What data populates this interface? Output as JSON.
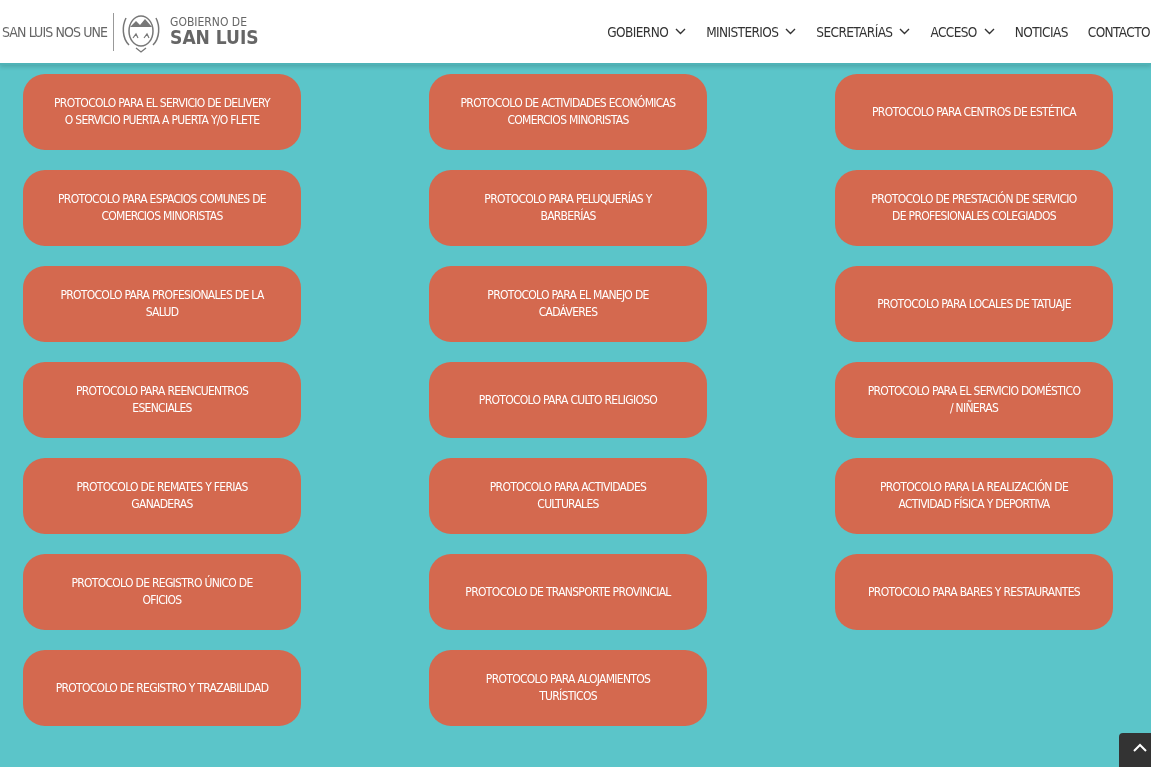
{
  "header": {
    "slogan": "SAN LUIS NOS UNE",
    "logo_line_1": "GOBIERNO DE",
    "logo_line_2": "SAN LUIS"
  },
  "nav": [
    {
      "label": "GOBIERNO",
      "dropdown": true
    },
    {
      "label": "MINISTERIOS",
      "dropdown": true
    },
    {
      "label": "SECRETARÍAS",
      "dropdown": true
    },
    {
      "label": "ACCESO",
      "dropdown": true
    },
    {
      "label": "NOTICIAS",
      "dropdown": false
    },
    {
      "label": "CONTACTO",
      "dropdown": false
    }
  ],
  "protocols": [
    {
      "label": "PROTOCOLO PARA EL SERVICIO DE DELIVERY O SERVICIO PUERTA A PUERTA Y/O FLETE"
    },
    {
      "label": "PROTOCOLO DE ACTIVIDADES ECONÓMICAS COMERCIOS MINORISTAS"
    },
    {
      "label": "PROTOCOLO PARA CENTROS DE ESTÉTICA"
    },
    {
      "label": "PROTOCOLO PARA ESPACIOS COMUNES DE COMERCIOS MINORISTAS"
    },
    {
      "label": "PROTOCOLO PARA PELUQUERÍAS Y BARBERÍAS"
    },
    {
      "label": "PROTOCOLO DE PRESTACIÓN DE SERVICIO DE PROFESIONALES COLEGIADOS"
    },
    {
      "label": "PROTOCOLO PARA PROFESIONALES DE LA SALUD"
    },
    {
      "label": "PROTOCOLO PARA EL MANEJO DE CADÁVERES"
    },
    {
      "label": "PROTOCOLO PARA LOCALES DE TATUAJE"
    },
    {
      "label": "PROTOCOLO PARA REENCUENTROS ESENCIALES"
    },
    {
      "label": "PROTOCOLO PARA CULTO RELIGIOSO"
    },
    {
      "label": "PROTOCOLO PARA EL SERVICIO DOMÉSTICO / NIÑERAS"
    },
    {
      "label": "PROTOCOLO DE REMATES Y FERIAS GANADERAS"
    },
    {
      "label": "PROTOCOLO PARA ACTIVIDADES CULTURALES"
    },
    {
      "label": "PROTOCOLO PARA LA REALIZACIÓN DE ACTIVIDAD FÍSICA Y DEPORTIVA"
    },
    {
      "label": "PROTOCOLO DE REGISTRO ÚNICO DE OFICIOS"
    },
    {
      "label": "PROTOCOLO DE TRANSPORTE PROVINCIAL"
    },
    {
      "label": "PROTOCOLO PARA BARES Y RESTAURANTES"
    },
    {
      "label": "PROTOCOLO DE REGISTRO Y TRAZABILIDAD"
    },
    {
      "label": "PROTOCOLO PARA ALOJAMIENTOS TURÍSTICOS"
    }
  ]
}
